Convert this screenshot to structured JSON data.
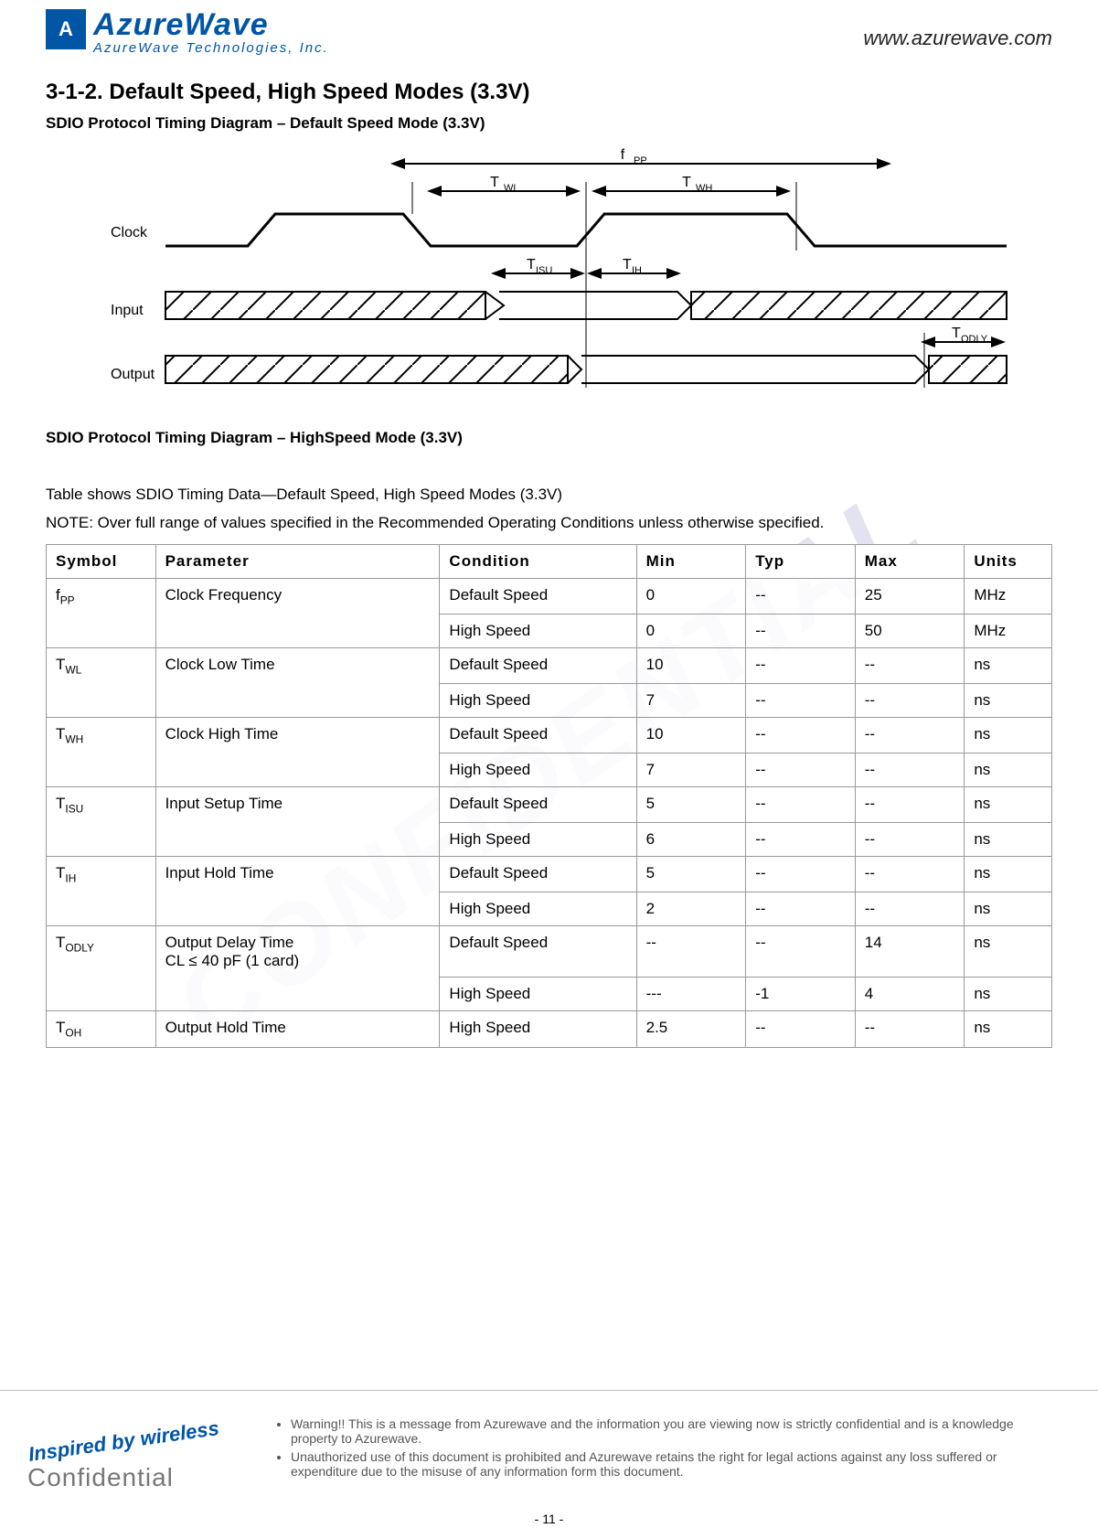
{
  "header": {
    "logo_name": "AzureWave",
    "logo_sub": "AzureWave  Technologies,  Inc.",
    "url": "www.azurewave.com"
  },
  "section": {
    "number_title": "3-1-2. Default Speed, High Speed Modes (3.3V)",
    "diagram1_caption": "SDIO Protocol Timing Diagram – Default Speed Mode (3.3V)",
    "diagram2_caption": "SDIO Protocol Timing Diagram – HighSpeed Mode (3.3V)",
    "table_intro": "Table shows SDIO Timing Data—Default Speed, High Speed Modes (3.3V)",
    "table_note": "NOTE: Over full range of values specified in the Recommended Operating Conditions unless otherwise specified."
  },
  "diagram_labels": {
    "clock": "Clock",
    "input": "Input",
    "output": "Output",
    "fpp": "fPP",
    "twl": "TWL",
    "twh": "TWH",
    "tisu": "TISU",
    "tih": "TIH",
    "todly": "TODLY"
  },
  "table": {
    "headers": {
      "symbol": "Symbol",
      "parameter": "Parameter",
      "condition": "Condition",
      "min": "Min",
      "typ": "Typ",
      "max": "Max",
      "units": "Units"
    },
    "rows": [
      {
        "sym_base": "f",
        "sym_sub": "PP",
        "param": "Clock Frequency",
        "cond": "Default Speed",
        "min": "0",
        "typ": "--",
        "max": "25",
        "unit": "MHz",
        "merge": "top"
      },
      {
        "sym_base": "",
        "sym_sub": "",
        "param": "",
        "cond": "High Speed",
        "min": "0",
        "typ": "--",
        "max": "50",
        "unit": "MHz",
        "merge": "bot"
      },
      {
        "sym_base": "T",
        "sym_sub": "WL",
        "param": "Clock Low Time",
        "cond": "Default Speed",
        "min": "10",
        "typ": "--",
        "max": "--",
        "unit": "ns",
        "merge": "top"
      },
      {
        "sym_base": "",
        "sym_sub": "",
        "param": "",
        "cond": "High Speed",
        "min": "7",
        "typ": "--",
        "max": "--",
        "unit": "ns",
        "merge": "bot"
      },
      {
        "sym_base": "T",
        "sym_sub": "WH",
        "param": "Clock High Time",
        "cond": "Default Speed",
        "min": "10",
        "typ": "--",
        "max": "--",
        "unit": "ns",
        "merge": "top"
      },
      {
        "sym_base": "",
        "sym_sub": "",
        "param": "",
        "cond": "High Speed",
        "min": "7",
        "typ": "--",
        "max": "--",
        "unit": "ns",
        "merge": "bot"
      },
      {
        "sym_base": "T",
        "sym_sub": "ISU",
        "param": "Input Setup Time",
        "cond": "Default Speed",
        "min": "5",
        "typ": "--",
        "max": "--",
        "unit": "ns",
        "merge": "top"
      },
      {
        "sym_base": "",
        "sym_sub": "",
        "param": "",
        "cond": "High Speed",
        "min": "6",
        "typ": "--",
        "max": "--",
        "unit": "ns",
        "merge": "bot"
      },
      {
        "sym_base": "T",
        "sym_sub": "IH",
        "param": "Input Hold Time",
        "cond": "Default Speed",
        "min": "5",
        "typ": "--",
        "max": "--",
        "unit": "ns",
        "merge": "top"
      },
      {
        "sym_base": "",
        "sym_sub": "",
        "param": "",
        "cond": "High Speed",
        "min": "2",
        "typ": "--",
        "max": "--",
        "unit": "ns",
        "merge": "bot"
      },
      {
        "sym_base": "T",
        "sym_sub": "ODLY",
        "param": "Output Delay Time\nCL ≤ 40 pF (1 card)",
        "cond": "Default Speed",
        "min": "--",
        "typ": "--",
        "max": "14",
        "unit": "ns",
        "merge": "top"
      },
      {
        "sym_base": "",
        "sym_sub": "",
        "param": "",
        "cond": "High Speed",
        "min": "---",
        "typ": "-1",
        "max": "4",
        "unit": "ns",
        "merge": "bot"
      },
      {
        "sym_base": "T",
        "sym_sub": "OH",
        "param": "Output Hold Time",
        "cond": "High Speed",
        "min": "2.5",
        "typ": "--",
        "max": "--",
        "unit": "ns",
        "merge": ""
      }
    ]
  },
  "watermark": "CONFIDENTIAL",
  "footer": {
    "inspired": "Inspired by wireless",
    "confidential": "Confidential",
    "note1": "Warning!! This is a message from Azurewave and the information you are viewing now is strictly confidential and is a knowledge property to Azurewave.",
    "note2": "Unauthorized use of this document is prohibited and Azurewave retains the right for legal actions against any loss suffered or expenditure due to the misuse of any information form this document.",
    "page_number": "- 11 -"
  }
}
